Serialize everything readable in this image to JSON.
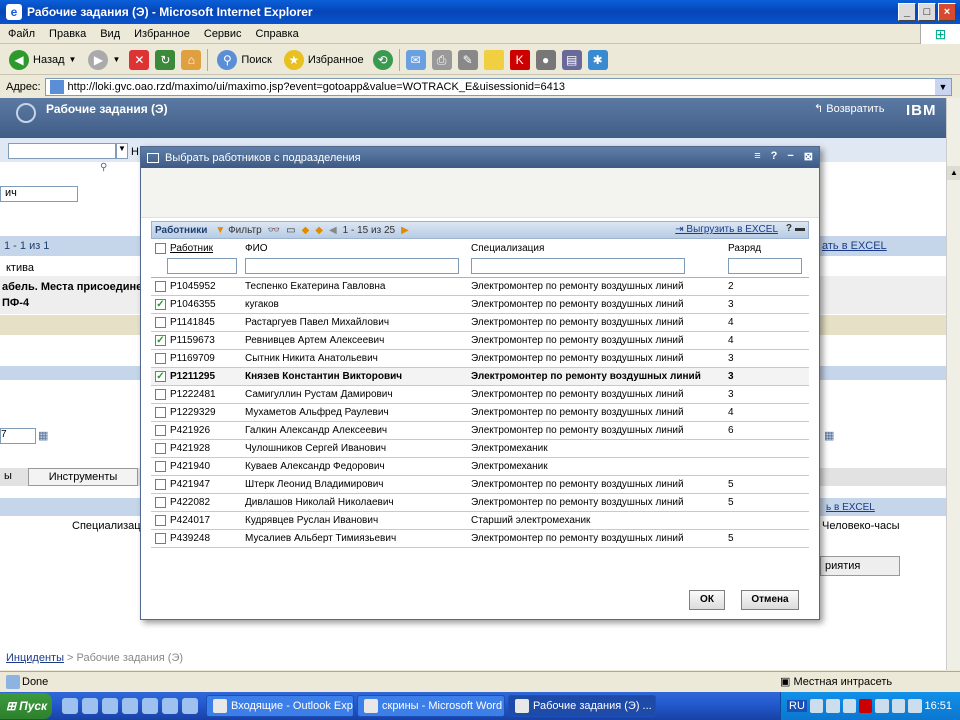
{
  "window": {
    "title": "Рабочие задания (Э) - Microsoft Internet Explorer"
  },
  "menu": [
    "Файл",
    "Правка",
    "Вид",
    "Избранное",
    "Сервис",
    "Справка"
  ],
  "toolbar": {
    "back_label": "Назад",
    "search_label": "Поиск",
    "favorites_label": "Избранное"
  },
  "address": {
    "label": "Адрес:",
    "url": "http://loki.gvc.oao.rzd/maximo/ui/maximo.jsp?event=gotoapp&value=WOTRACK_E&uisessionid=6413"
  },
  "app": {
    "title": "Рабочие задания (Э)",
    "back_label": "Возвратить",
    "logo": "IBM",
    "bg_frag_name": "ич",
    "bg_count": "1 - 1 из 1",
    "bg_export": "ать в EXCEL",
    "bg_col": "ктива",
    "bg_row1": "абель. Места присоедине",
    "bg_row2": "ПФ-4",
    "bg_date": "7",
    "bg_tab1": "ы",
    "bg_tab2": "Инструменты",
    "bg_col_spec": "Специализаци",
    "bg_col_hours": "Человеко-часы",
    "bg_export2": "ь в EXCEL",
    "bg_btn": "риятия",
    "breadcrumb_link": "Инциденты",
    "breadcrumb_sep": " > ",
    "breadcrumb_current": "Рабочие задания (Э)"
  },
  "dialog": {
    "title": "Выбрать работников с подразделения",
    "table_title": "Работники",
    "filter_label": "Фильтр",
    "paging": "1 - 15 из 25",
    "export_label": "Выгрузить в EXCEL",
    "columns": [
      "Работник",
      "ФИО",
      "Специализация",
      "Разряд"
    ],
    "rows": [
      {
        "checked": false,
        "selected": false,
        "id": "P1045952",
        "name": "Теспенко Екатерина Гавловна",
        "spec": "Электромонтер по ремонту воздушных линий",
        "grade": "2"
      },
      {
        "checked": true,
        "selected": false,
        "id": "P1046355",
        "name": "кугаков",
        "spec": "Электромонтер по ремонту воздушных линий",
        "grade": "3"
      },
      {
        "checked": false,
        "selected": false,
        "id": "P1141845",
        "name": "Растаргуев Павел Михайлович",
        "spec": "Электромонтер по ремонту воздушных линий",
        "grade": "4"
      },
      {
        "checked": true,
        "selected": false,
        "id": "P1159673",
        "name": "Ревнивцев Артем Алексеевич",
        "spec": "Электромонтер по ремонту воздушных линий",
        "grade": "4"
      },
      {
        "checked": false,
        "selected": false,
        "id": "P1169709",
        "name": "Сытник Никита Анатольевич",
        "spec": "Электромонтер по ремонту воздушных линий",
        "grade": "3"
      },
      {
        "checked": true,
        "selected": true,
        "id": "P1211295",
        "name": "Князев Константин Викторович",
        "spec": "Электромонтер по ремонту воздушных линий",
        "grade": "3"
      },
      {
        "checked": false,
        "selected": false,
        "id": "P1222481",
        "name": "Самигуллин Рустам Дамирович",
        "spec": "Электромонтер по ремонту воздушных линий",
        "grade": "3"
      },
      {
        "checked": false,
        "selected": false,
        "id": "P1229329",
        "name": "Мухаметов Альфред Раулевич",
        "spec": "Электромонтер по ремонту воздушных линий",
        "grade": "4"
      },
      {
        "checked": false,
        "selected": false,
        "id": "P421926",
        "name": "Галкин Александр Алексеевич",
        "spec": "Электромонтер по ремонту воздушных линий",
        "grade": "6"
      },
      {
        "checked": false,
        "selected": false,
        "id": "P421928",
        "name": "Чулошников Сергей Иванович",
        "spec": "Электромеханик",
        "grade": ""
      },
      {
        "checked": false,
        "selected": false,
        "id": "P421940",
        "name": "Куваев Александр Федорович",
        "spec": "Электромеханик",
        "grade": ""
      },
      {
        "checked": false,
        "selected": false,
        "id": "P421947",
        "name": "Штерк Леонид Владимирович",
        "spec": "Электромонтер по ремонту воздушных линий",
        "grade": "5"
      },
      {
        "checked": false,
        "selected": false,
        "id": "P422082",
        "name": "Дивлашов Николай Николаевич",
        "spec": "Электромонтер по ремонту воздушных линий",
        "grade": "5"
      },
      {
        "checked": false,
        "selected": false,
        "id": "P424017",
        "name": "Кудрявцев Руслан Иванович",
        "spec": "Старший электромеханик",
        "grade": ""
      },
      {
        "checked": false,
        "selected": false,
        "id": "P439248",
        "name": "Мусалиев Альберт Тимиязьевич",
        "spec": "Электромонтер по ремонту воздушных линий",
        "grade": "5"
      }
    ],
    "ok_label": "ОК",
    "cancel_label": "Отмена"
  },
  "status": {
    "text": "Done",
    "zone": "Местная интрасеть"
  },
  "taskbar": {
    "start_label": "Пуск",
    "tasks": [
      "Входящие - Outlook Exp...",
      "скрины - Microsoft Word",
      "Рабочие задания (Э) ..."
    ],
    "lang": "RU",
    "clock": "16:51"
  }
}
